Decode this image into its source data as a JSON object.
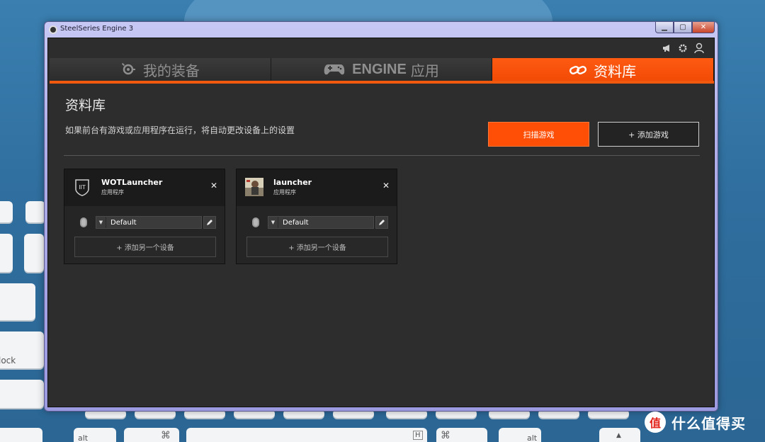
{
  "window": {
    "title": "SteelSeries Engine 3"
  },
  "tabs": [
    {
      "label": "我的装备",
      "icon": "steelseries-logo-icon",
      "active": false
    },
    {
      "label_en": "ENGINE",
      "label": "应用",
      "icon": "gamepad-icon",
      "active": false
    },
    {
      "label": "资料库",
      "icon": "link-icon",
      "active": true
    }
  ],
  "library": {
    "heading": "资料库",
    "description": "如果前台有游戏或应用程序在运行，将自动更改设备上的设置",
    "scan_button": "扫描游戏",
    "add_game_button": "+ 添加游戏"
  },
  "cards": [
    {
      "name": "WOTLauncher",
      "type": "应用程序",
      "profile": "Default",
      "add_device": "+ 添加另一个设备",
      "thumb_icon": "world-of-tanks-icon"
    },
    {
      "name": "launcher",
      "type": "应用程序",
      "profile": "Default",
      "add_device": "+ 添加另一个设备",
      "thumb_icon": "game-character-icon"
    }
  ],
  "desktop": {
    "keys": {
      "lock": "lock",
      "alt_left": "alt",
      "cmd_left": "⌘",
      "cmd_right": "⌘",
      "alt_right": "alt",
      "arrow_up": "▲",
      "h_key": "H"
    }
  },
  "watermark": {
    "badge": "值",
    "text": "什么值得买"
  },
  "colors": {
    "accent": "#ff4e05",
    "panel_bg": "#2d2d2d",
    "tab_bg": "#333333"
  }
}
